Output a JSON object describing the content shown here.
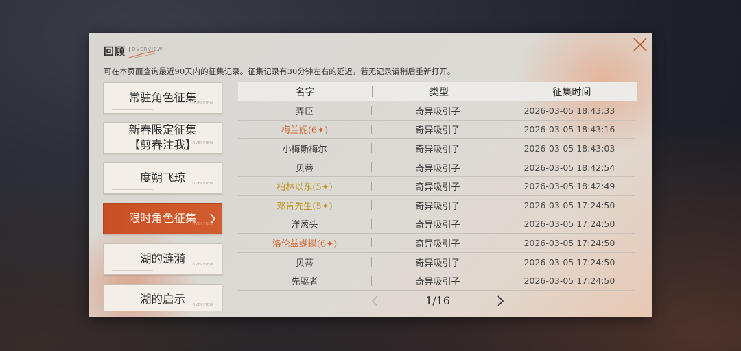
{
  "panel": {
    "title": "回顾",
    "title_sub": "OVERVIEW",
    "description": "可在本页面查询最近90天内的征集记录。征集记录有30分钟左右的延迟，若无记录请稍后重新打开。",
    "close_icon": "close-icon"
  },
  "sidebar": {
    "deco_text": "OVERVIEW",
    "items": [
      {
        "label": "常驻角色征集",
        "active": false
      },
      {
        "label": "新春限定征集\n【剪春注我】",
        "active": false
      },
      {
        "label": "度朔飞琼",
        "active": false
      },
      {
        "label": "限时角色征集",
        "active": true
      },
      {
        "label": "湖的涟漪",
        "active": false
      },
      {
        "label": "湖的启示",
        "active": false
      }
    ]
  },
  "table": {
    "headers": [
      "名字",
      "类型",
      "征集时间"
    ],
    "rows": [
      {
        "name": "弄臣",
        "type": "奇异吸引子",
        "time": "2026-03-05 18:43:33",
        "rarity": "normal"
      },
      {
        "name": "梅兰妮(6✦)",
        "type": "奇异吸引子",
        "time": "2026-03-05 18:43:16",
        "rarity": "six"
      },
      {
        "name": "小梅斯梅尔",
        "type": "奇异吸引子",
        "time": "2026-03-05 18:43:03",
        "rarity": "normal"
      },
      {
        "name": "贝蒂",
        "type": "奇异吸引子",
        "time": "2026-03-05 18:42:54",
        "rarity": "normal"
      },
      {
        "name": "柏林以东(5✦)",
        "type": "奇异吸引子",
        "time": "2026-03-05 18:42:49",
        "rarity": "five"
      },
      {
        "name": "邓肯先生(5✦)",
        "type": "奇异吸引子",
        "time": "2026-03-05 17:24:50",
        "rarity": "five"
      },
      {
        "name": "洋葱头",
        "type": "奇异吸引子",
        "time": "2026-03-05 17:24:50",
        "rarity": "normal"
      },
      {
        "name": "洛伦兹蝴蝶(6✦)",
        "type": "奇异吸引子",
        "time": "2026-03-05 17:24:50",
        "rarity": "six"
      },
      {
        "name": "贝蒂",
        "type": "奇异吸引子",
        "time": "2026-03-05 17:24:50",
        "rarity": "normal"
      },
      {
        "name": "先驱者",
        "type": "奇异吸引子",
        "time": "2026-03-05 17:24:50",
        "rarity": "normal"
      }
    ]
  },
  "pager": {
    "text": "1/16",
    "prev_icon": "chevron-left-icon",
    "next_icon": "chevron-right-icon"
  },
  "colors": {
    "accent": "#cf5a2c",
    "six_star": "#d2632b",
    "five_star": "#c1931d"
  }
}
